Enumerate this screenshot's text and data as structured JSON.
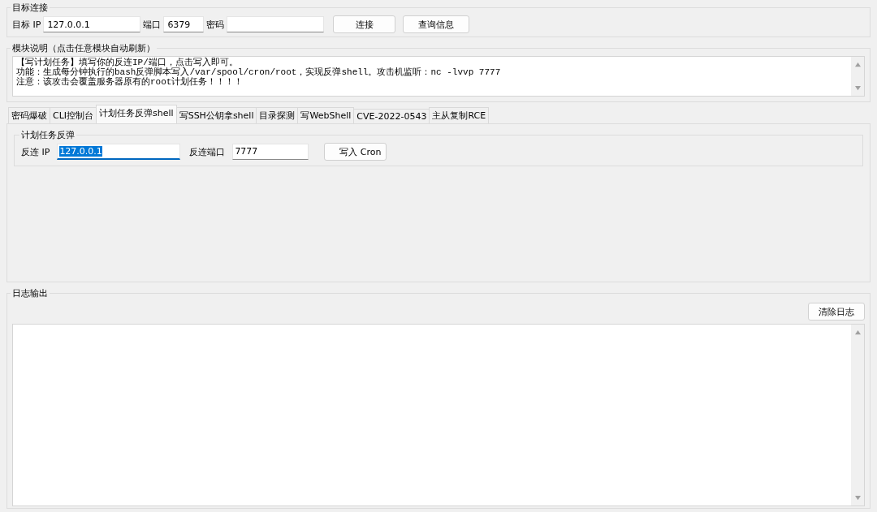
{
  "target": {
    "title": "目标连接",
    "fields": [
      {
        "label": "目标 IP",
        "value": "127.0.0.1"
      },
      {
        "label": "端口",
        "value": "6379"
      },
      {
        "label": "密码"
      }
    ],
    "buttons": [
      "连接",
      "查询信息"
    ]
  },
  "module": {
    "title": "模块说明（点击任意模块自动刷新）",
    "lines": [
      "【写计划任务】填写你的反连IP/端口，点击写入即可。",
      "功能：生成每分钟执行的bash反弹脚本写入/var/spool/cron/root，实现反弹shell。攻击机监听：nc -lvvp 7777",
      "注意：该攻击会覆盖服务器原有的root计划任务！！！！"
    ]
  },
  "tabs": [
    {
      "label": "密码爆破",
      "selected": false
    },
    {
      "label": "CLI控制台",
      "selected": false
    },
    {
      "label": "计划任务反弹shell",
      "selected": true
    },
    {
      "label": "写SSH公钥拿shell",
      "selected": false
    },
    {
      "label": "目录探测",
      "selected": false
    },
    {
      "label": "写WebShell",
      "selected": false
    },
    {
      "label": "CVE-2022-0543",
      "selected": false
    },
    {
      "label": "主从复制RCE",
      "selected": false
    }
  ],
  "panel": {
    "title": "计划任务反弹",
    "fields": [
      {
        "label": "反连 IP",
        "value": "127.0.0.1",
        "focused": true,
        "value_selected": true
      },
      {
        "label": "反连端口",
        "value": "7777",
        "focused": false,
        "value_selected": false
      }
    ],
    "button": "写入 Cron"
  },
  "log": {
    "title": "日志输出",
    "clear_button": "清除日志"
  }
}
